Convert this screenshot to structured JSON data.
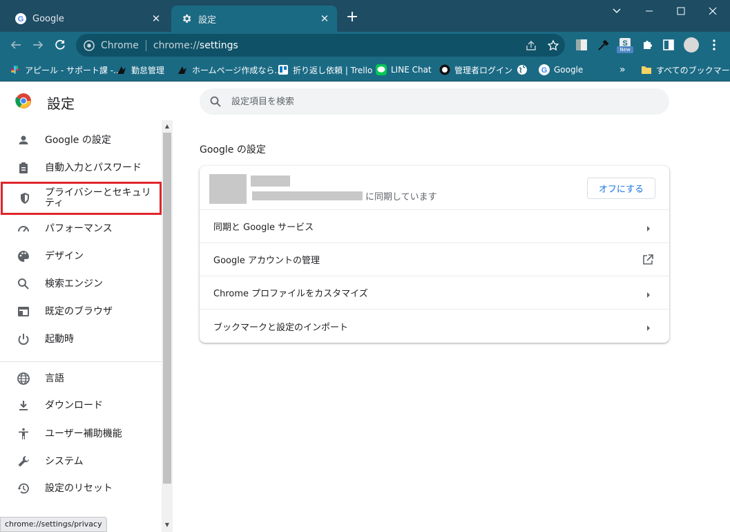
{
  "tabs": [
    {
      "title": "Google",
      "icon": "google-g-icon"
    },
    {
      "title": "設定",
      "icon": "gear-icon"
    }
  ],
  "window_controls": {
    "minimize": "minimize-icon",
    "maximize": "maximize-icon",
    "close": "close-icon"
  },
  "omnibox": {
    "label": "Chrome",
    "url_scheme": "chrome://",
    "url_path": "settings"
  },
  "bookmarks": [
    {
      "label": "アピール - サポート課 -...",
      "icon": "slack-icon"
    },
    {
      "label": "勤怠管理",
      "icon": "bird-icon"
    },
    {
      "label": "ホームページ作成なら...",
      "icon": "bird-icon"
    },
    {
      "label": "折り返し依頼 | Trello",
      "icon": "trello-icon"
    },
    {
      "label": "LINE Chat",
      "icon": "line-icon"
    },
    {
      "label": "管理者ログイン",
      "icon": "admin-icon"
    },
    {
      "label": "",
      "icon": "globe-icon"
    },
    {
      "label": "Google",
      "icon": "google-g-icon"
    }
  ],
  "bookmarks_overflow": "»",
  "all_bookmarks": "すべてのブックマーク",
  "ext_badge": "New",
  "header": {
    "title": "設定",
    "search_placeholder": "設定項目を検索"
  },
  "sidebar": {
    "items": [
      {
        "label": "Google の設定",
        "icon": "person-icon"
      },
      {
        "label": "自動入力とパスワード",
        "icon": "clipboard-icon"
      },
      {
        "label": "プライバシーとセキュリティ",
        "icon": "shield-icon",
        "highlighted": true
      },
      {
        "label": "パフォーマンス",
        "icon": "speedometer-icon"
      },
      {
        "label": "デザイン",
        "icon": "palette-icon"
      },
      {
        "label": "検索エンジン",
        "icon": "search-icon"
      },
      {
        "label": "既定のブラウザ",
        "icon": "browser-icon"
      },
      {
        "label": "起動時",
        "icon": "power-icon"
      },
      {
        "label": "言語",
        "icon": "globe-icon"
      },
      {
        "label": "ダウンロード",
        "icon": "download-icon"
      },
      {
        "label": "ユーザー補助機能",
        "icon": "accessibility-icon"
      },
      {
        "label": "システム",
        "icon": "wrench-icon"
      },
      {
        "label": "設定のリセット",
        "icon": "history-icon"
      }
    ]
  },
  "main": {
    "section_title": "Google の設定",
    "account": {
      "sync_text": "に同期しています",
      "off_button": "オフにする"
    },
    "rows": [
      {
        "label": "同期と Google サービス",
        "icon": "chevron-right-icon"
      },
      {
        "label": "Google アカウントの管理",
        "icon": "external-link-icon"
      },
      {
        "label": "Chrome プロファイルをカスタマイズ",
        "icon": "chevron-right-icon"
      },
      {
        "label": "ブックマークと設定のインポート",
        "icon": "chevron-right-icon"
      }
    ]
  },
  "status_bar": "chrome://settings/privacy",
  "colors": {
    "frame": "#1d4c63",
    "toolbar": "#1b6a84",
    "accent": "#1a73e8",
    "highlight_border": "#e0252b"
  }
}
